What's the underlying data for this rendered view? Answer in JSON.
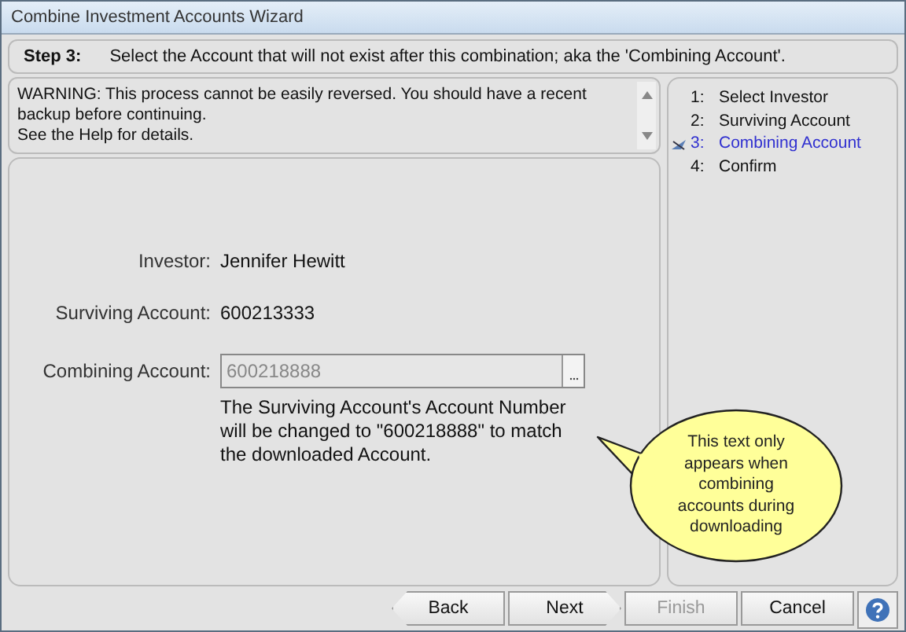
{
  "window": {
    "title": "Combine Investment Accounts Wizard"
  },
  "step_header": {
    "label": "Step 3:",
    "instruction": "Select the Account that will not exist after this combination; aka the 'Combining Account'."
  },
  "warning": [
    "WARNING:  This process cannot be easily reversed. You should have a recent backup before continuing.",
    "See the Help for details."
  ],
  "fields": [
    {
      "kind": "text",
      "label": "Investor:",
      "value": "Jennifer Hewitt"
    },
    {
      "kind": "text",
      "label": "Surviving Account:",
      "value": "600213333"
    },
    {
      "kind": "input",
      "label": "Combining Account:",
      "value": "600218888",
      "disabled": true
    }
  ],
  "note": "The Surviving Account's Account Number will be changed to \"600218888\" to match the downloaded Account.",
  "callout": "This text only appears when combining accounts during downloading",
  "steps": [
    {
      "number": "1:",
      "label": "Select Investor",
      "selected": false
    },
    {
      "number": "2:",
      "label": "Surviving Account",
      "selected": false
    },
    {
      "number": "3:",
      "label": "Combining Account",
      "selected": true
    },
    {
      "number": "4:",
      "label": "Confirm",
      "selected": false
    }
  ],
  "buttons": [
    {
      "kind": "back",
      "label": "Back",
      "disabled": false
    },
    {
      "kind": "next",
      "label": "Next",
      "disabled": false
    },
    {
      "kind": "plain",
      "label": "Finish",
      "disabled": true
    },
    {
      "kind": "plain",
      "label": "Cancel",
      "disabled": false
    }
  ]
}
